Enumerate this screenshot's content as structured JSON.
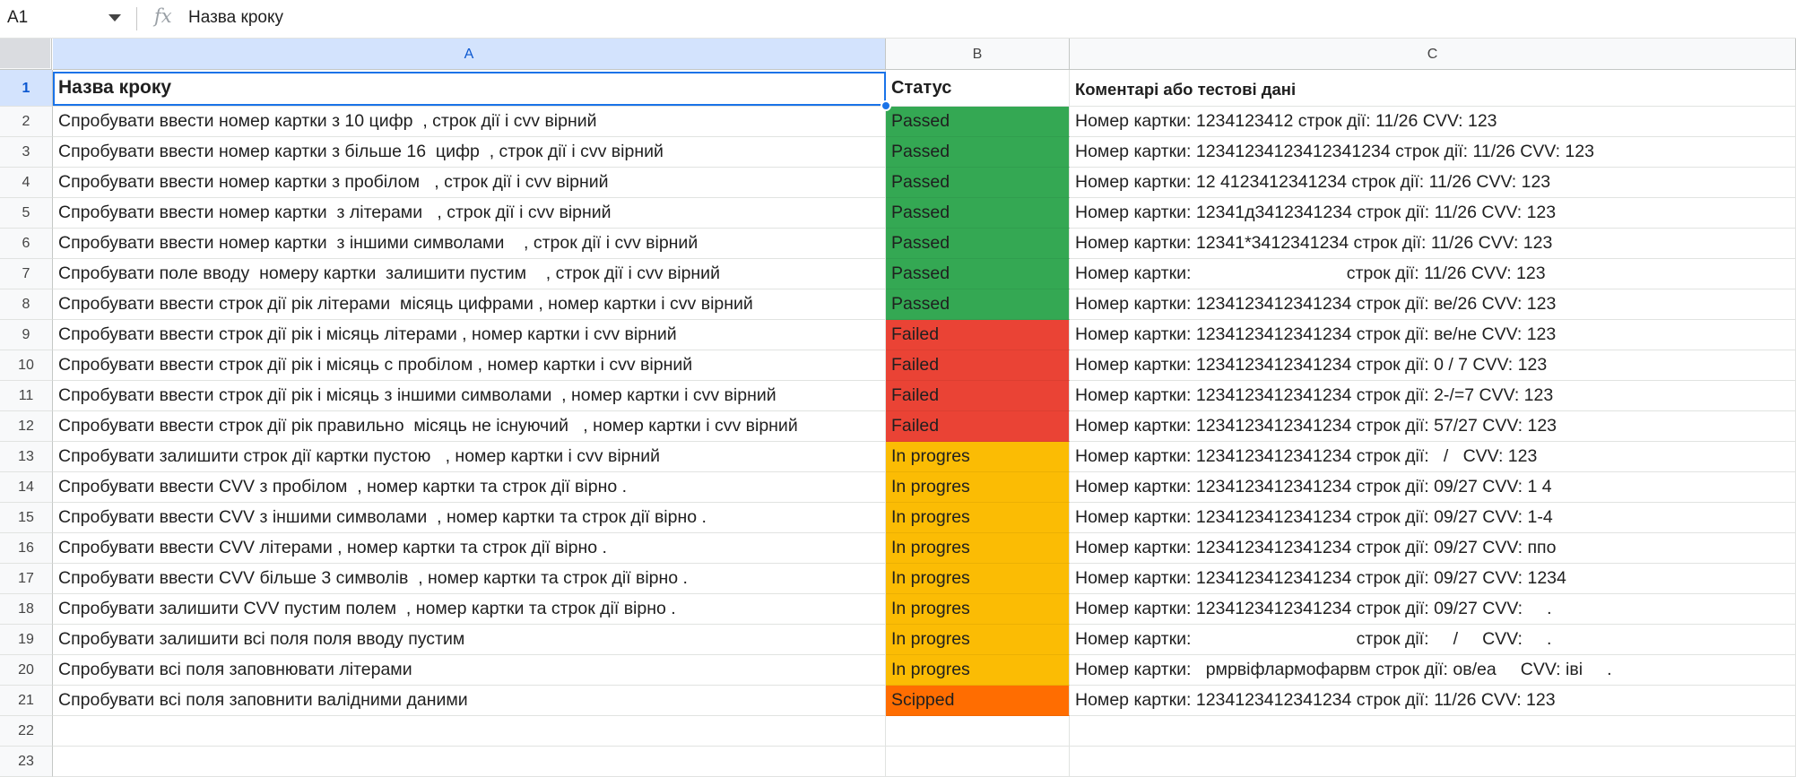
{
  "formula_bar": {
    "cell_ref": "A1",
    "fx_icon": "fx",
    "content": "Назва кроку"
  },
  "colors": {
    "passed": "#34a853",
    "failed": "#ea4335",
    "in_progress": "#fbbc04",
    "skipped": "#ff6d01",
    "selection": "#1a73e8"
  },
  "columns": [
    "A",
    "B",
    "C"
  ],
  "row_numbers": [
    "1",
    "2",
    "3",
    "4",
    "5",
    "6",
    "7",
    "8",
    "9",
    "10",
    "11",
    "12",
    "13",
    "14",
    "15",
    "16",
    "17",
    "18",
    "19",
    "20",
    "21",
    "22",
    "23"
  ],
  "header": {
    "a": "Назва кроку",
    "b": "Статус",
    "c": "Коментарі або тестові дані"
  },
  "rows": [
    {
      "a": "Спробувати ввести номер картки з 10 цифр  , строк дії і cvv вірний",
      "b": "Passed",
      "c": "Номер картки: 1234123412 строк дії: 11/26 CVV: 123"
    },
    {
      "a": "Спробувати ввести номер картки з більше 16  цифр  , строк дії і cvv вірний",
      "b": "Passed",
      "c": "Номер картки: 12341234123412341234 строк дії: 11/26 CVV: 123"
    },
    {
      "a": "Спробувати ввести номер картки з пробілом   , строк дії і cvv вірний",
      "b": "Passed",
      "c": "Номер картки: 12 4123412341234 строк дії: 11/26 CVV: 123"
    },
    {
      "a": "Спробувати ввести номер картки  з літерами   , строк дії і cvv вірний",
      "b": "Passed",
      "c": "Номер картки: 12341д3412341234 строк дії: 11/26 CVV: 123"
    },
    {
      "a": "Спробувати ввести номер картки  з іншими символами    , строк дії і cvv вірний",
      "b": "Passed",
      "c": "Номер картки: 12341*3412341234 строк дії: 11/26 CVV: 123"
    },
    {
      "a": "Спробувати поле вводу  номеру картки  залишити пустим    , строк дії і cvv вірний",
      "b": "Passed",
      "c": "Номер картки:                                строк дії: 11/26 CVV: 123"
    },
    {
      "a": "Спробувати ввести строк дії рік літерами  місяць цифрами , номер картки і cvv вірний",
      "b": "Passed",
      "c": "Номер картки: 1234123412341234 строк дії: ве/26 CVV: 123"
    },
    {
      "a": "Спробувати ввести строк дії рік і місяць літерами , номер картки і cvv вірний",
      "b": "Failed",
      "c": "Номер картки: 1234123412341234 строк дії: ве/не CVV: 123"
    },
    {
      "a": "Спробувати ввести строк дії рік і місяць с пробілом , номер картки і cvv вірний",
      "b": "Failed",
      "c": "Номер картки: 1234123412341234 строк дії: 0 / 7 CVV: 123"
    },
    {
      "a": "Спробувати ввести строк дії рік і місяць з іншими символами  , номер картки і cvv вірний",
      "b": "Failed",
      "c": "Номер картки: 1234123412341234 строк дії: 2-/=7 CVV: 123"
    },
    {
      "a": "Спробувати ввести строк дії рік правильно  місяць не існуючий   , номер картки і cvv вірний",
      "b": "Failed",
      "c": "Номер картки: 1234123412341234 строк дії: 57/27 CVV: 123"
    },
    {
      "a": "Спробувати залишити строк дії картки пустою   , номер картки і cvv вірний",
      "b": "In progres",
      "c": "Номер картки: 1234123412341234 строк дії:   /   CVV: 123"
    },
    {
      "a": "Спробувати ввести CVV з пробілом  , номер картки та строк дії вірно .",
      "b": "In progres",
      "c": "Номер картки: 1234123412341234 строк дії: 09/27 CVV: 1 4"
    },
    {
      "a": "Спробувати ввести CVV з іншими символами  , номер картки та строк дії вірно .",
      "b": "In progres",
      "c": "Номер картки: 1234123412341234 строк дії: 09/27 CVV: 1-4"
    },
    {
      "a": "Спробувати ввести CVV літерами , номер картки та строк дії вірно .",
      "b": "In progres",
      "c": "Номер картки: 1234123412341234 строк дії: 09/27 CVV: ппо"
    },
    {
      "a": "Спробувати ввести CVV більше 3 символів  , номер картки та строк дії вірно .",
      "b": "In progres",
      "c": "Номер картки: 1234123412341234 строк дії: 09/27 CVV: 1234"
    },
    {
      "a": "Спробувати залишити CVV пустим полем  , номер картки та строк дії вірно .",
      "b": "In progres",
      "c": "Номер картки: 1234123412341234 строк дії: 09/27 CVV:     ."
    },
    {
      "a": "Спробувати залишити всі поля поля вводу пустим",
      "b": "In progres",
      "c": "Номер картки:                                  строк дії:     /     CVV:     ."
    },
    {
      "a": "Спробувати всі поля заповнювати літерами",
      "b": "In progres",
      "c": "Номер картки:   рмрвіфлармофарвм строк дії: ов/еа     CVV: іві     ."
    },
    {
      "a": "Спробувати всі поля заповнити валідними даними",
      "b": "Scipped",
      "c": "Номер картки: 1234123412341234 строк дії: 11/26 CVV: 123"
    }
  ]
}
